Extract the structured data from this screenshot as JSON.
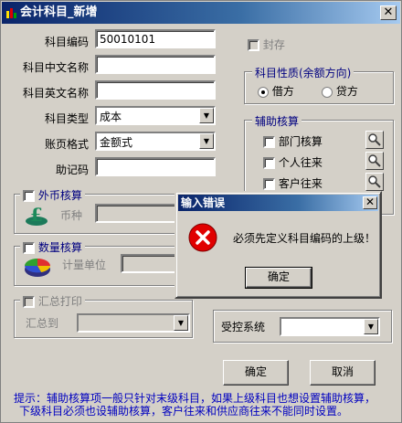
{
  "window": {
    "title": "会计科目_新增"
  },
  "form": {
    "code_label": "科目编码",
    "code_value": "50010101",
    "cn_name_label": "科目中文名称",
    "cn_name_value": "",
    "en_name_label": "科目英文名称",
    "en_name_value": "",
    "type_label": "科目类型",
    "type_value": "成本",
    "ledger_label": "账页格式",
    "ledger_value": "金额式",
    "mnemonic_label": "助记码",
    "mnemonic_value": ""
  },
  "sealed": {
    "label": "封存"
  },
  "nature": {
    "title": "科目性质(余额方向)",
    "debit": "借方",
    "credit": "贷方",
    "selected": "debit"
  },
  "aux": {
    "title": "辅助核算",
    "items": [
      "部门核算",
      "个人往来",
      "客户往来"
    ]
  },
  "foreign": {
    "title": "外币核算",
    "currency_label": "币种"
  },
  "quantity": {
    "title": "数量核算",
    "unit_label": "计量单位"
  },
  "summary": {
    "title": "汇总打印",
    "to_label": "汇总到"
  },
  "controlled": {
    "label": "受控系统",
    "value": ""
  },
  "buttons": {
    "ok": "确定",
    "cancel": "取消"
  },
  "hint": {
    "line1": "提示：辅助核算项一般只针对末级科目，如果上级科目也想设置辅助核算，",
    "line2": "下级科目必须也设辅助核算，客户往来和供应商往来不能同时设置。"
  },
  "dialog": {
    "title": "输入错误",
    "message": "必须先定义科目编码的上级！",
    "ok": "确定"
  },
  "icons": {
    "window": "app-icon",
    "error": "error-icon",
    "search": "magnifier-icon",
    "currency": "pound-coin-icon",
    "quantity": "pie-chart-icon"
  }
}
